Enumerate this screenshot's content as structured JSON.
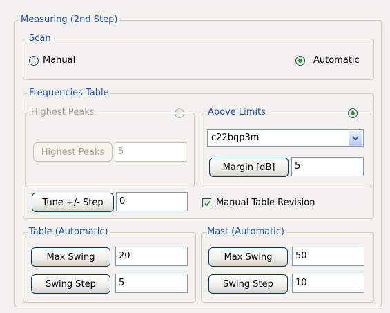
{
  "measuring": {
    "title": "Measuring (2nd Step)",
    "scan": {
      "title": "Scan",
      "manual_label": "Manual",
      "automatic_label": "Automatic",
      "selected": "Automatic"
    },
    "frequencies_table": {
      "title": "Frequencies Table",
      "highest_peaks": {
        "title": "Highest Peaks",
        "enabled": false,
        "button_label": "Highest Peaks",
        "value": "5"
      },
      "above_limits": {
        "title": "Above Limits",
        "enabled": true,
        "combo_value": "c22bqp3m",
        "margin_button_label": "Margin [dB]",
        "margin_value": "5"
      },
      "tune_step_label": "Tune +/- Step",
      "tune_step_value": "0",
      "manual_revision_label": "Manual Table Revision",
      "manual_revision_checked": true
    },
    "table_automatic": {
      "title": "Table (Automatic)",
      "max_swing_label": "Max Swing",
      "max_swing_value": "20",
      "swing_step_label": "Swing Step",
      "swing_step_value": "5"
    },
    "mast_automatic": {
      "title": "Mast (Automatic)",
      "max_swing_label": "Max Swing",
      "max_swing_value": "50",
      "swing_step_label": "Swing Step",
      "swing_step_value": "10"
    }
  },
  "colors": {
    "group_title": "#1a52c9",
    "disabled_text": "#a4a399",
    "radio_checked": "#21a121"
  }
}
